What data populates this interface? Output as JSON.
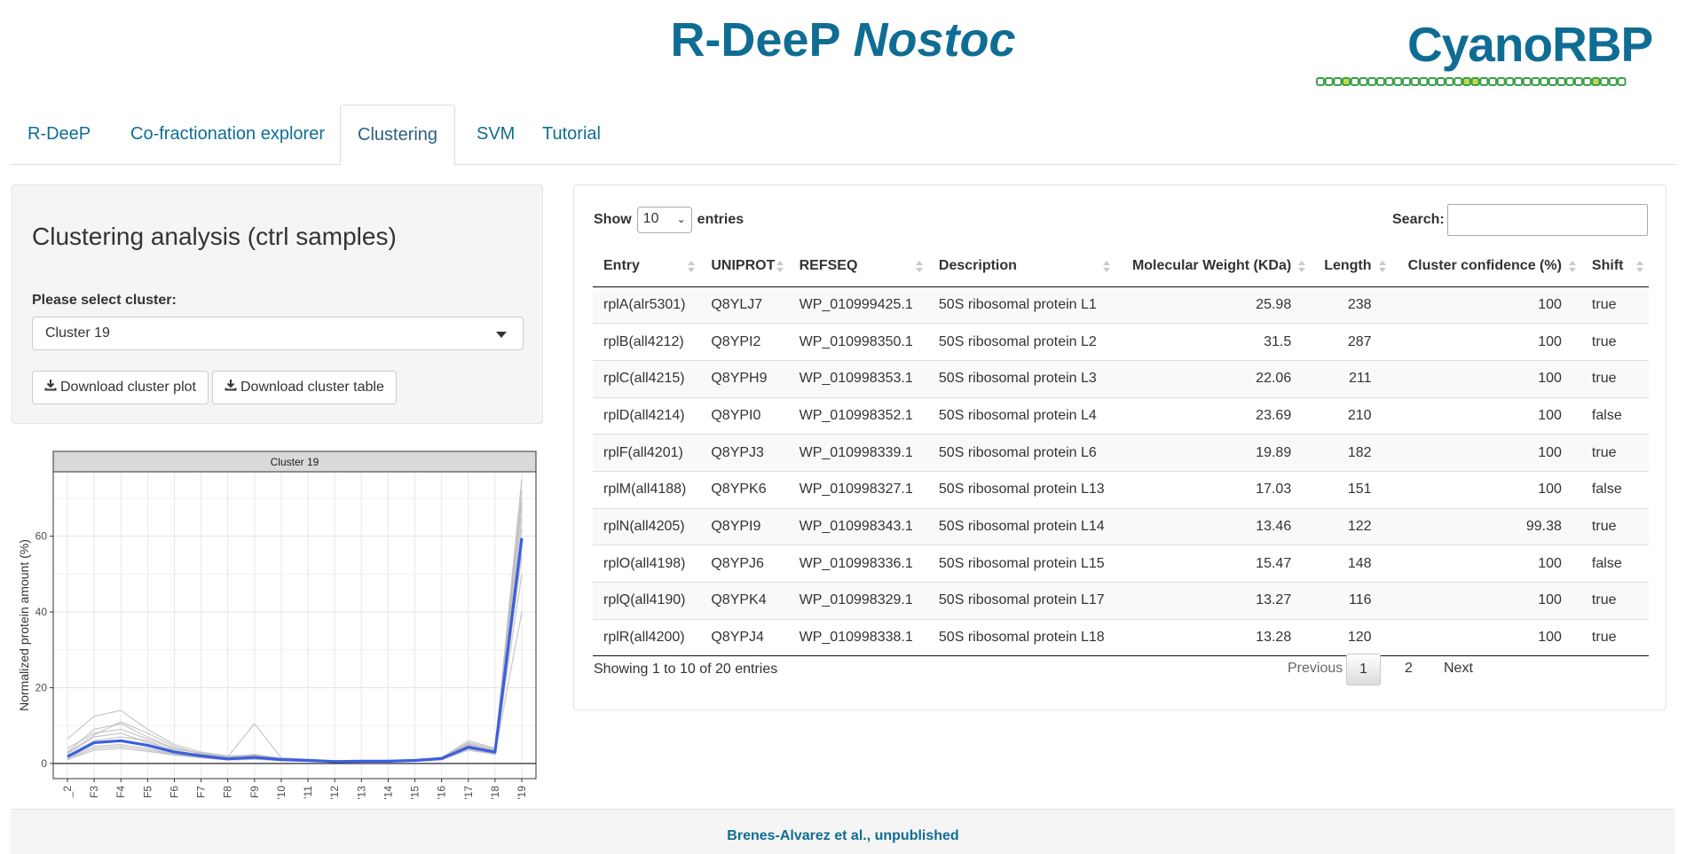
{
  "header": {
    "title_main": "R-DeeP",
    "title_italic": "Nostoc",
    "brand": "CyanoRBP"
  },
  "tabs": [
    {
      "label": "R-DeeP",
      "active": false
    },
    {
      "label": "Co-fractionation explorer",
      "active": false
    },
    {
      "label": "Clustering",
      "active": true
    },
    {
      "label": "SVM",
      "active": false
    },
    {
      "label": "Tutorial",
      "active": false
    }
  ],
  "sidebar": {
    "title": "Clustering analysis (ctrl samples)",
    "select_label": "Please select cluster:",
    "select_value": "Cluster 19",
    "download_plot": "Download cluster plot",
    "download_table": "Download cluster table"
  },
  "chart_data": {
    "type": "line",
    "title": "Cluster 19",
    "ylabel": "Normalized protein amount (%)",
    "xlabel": "",
    "categories": [
      "_2",
      "F3",
      "F4",
      "F5",
      "F6",
      "F7",
      "F8",
      "F9",
      "F10",
      "F11",
      "F12",
      "F13",
      "F14",
      "F15",
      "F16",
      "F17",
      "F18",
      "F19"
    ],
    "tick_labels": [
      "_2",
      "F3",
      "F4",
      "F5",
      "F6",
      "F7",
      "F8",
      "F9",
      "'10",
      "'11",
      "'12",
      "'13",
      "'14",
      "'15",
      "'16",
      "'17",
      "'18",
      "'19"
    ],
    "y_ticks": [
      "0",
      "20",
      "40",
      "60"
    ],
    "ylim": [
      -4,
      77
    ],
    "grid": true,
    "series": [
      {
        "values": [
          1.8,
          5.5,
          6.0,
          4.8,
          3.0,
          2.0,
          1.2,
          1.6,
          1.0,
          0.8,
          0.5,
          0.6,
          0.6,
          0.8,
          1.3,
          4.3,
          3.0,
          59.5
        ],
        "highlight": true
      },
      {
        "values": [
          2.5,
          7.0,
          8.0,
          5.5,
          3.5,
          2.2,
          1.5,
          2.0,
          1.2,
          1.0,
          0.6,
          0.7,
          0.7,
          0.9,
          1.5,
          5.0,
          3.5,
          72.0
        ]
      },
      {
        "values": [
          1.5,
          4.5,
          5.0,
          4.0,
          2.5,
          1.8,
          1.0,
          1.3,
          0.9,
          0.7,
          0.4,
          0.5,
          0.5,
          0.7,
          1.1,
          3.8,
          2.6,
          40.0
        ]
      },
      {
        "values": [
          3.0,
          9.0,
          10.5,
          7.0,
          4.0,
          2.6,
          1.8,
          10.5,
          1.5,
          1.1,
          0.7,
          0.7,
          0.8,
          1.0,
          1.6,
          5.5,
          3.8,
          68.0
        ]
      },
      {
        "values": [
          6.5,
          12.5,
          14.0,
          9.0,
          5.0,
          3.0,
          2.0,
          2.2,
          1.4,
          1.0,
          0.6,
          0.6,
          0.7,
          0.9,
          1.4,
          4.8,
          3.2,
          65.0
        ]
      },
      {
        "values": [
          1.0,
          3.5,
          4.0,
          3.2,
          2.2,
          1.5,
          0.9,
          1.1,
          0.8,
          0.6,
          0.4,
          0.4,
          0.5,
          0.6,
          1.0,
          3.5,
          2.4,
          55.0
        ]
      },
      {
        "values": [
          2.0,
          6.0,
          7.0,
          6.0,
          3.2,
          2.4,
          1.4,
          1.8,
          1.1,
          0.9,
          0.5,
          0.6,
          0.6,
          0.8,
          1.2,
          4.5,
          3.1,
          62.0
        ]
      },
      {
        "values": [
          4.0,
          8.0,
          9.0,
          6.5,
          3.8,
          2.8,
          1.6,
          2.4,
          1.3,
          1.0,
          0.6,
          0.7,
          0.7,
          0.9,
          1.5,
          6.0,
          4.0,
          75.0
        ]
      },
      {
        "values": [
          1.2,
          4.0,
          4.5,
          3.6,
          2.4,
          1.6,
          1.1,
          1.2,
          0.8,
          0.7,
          0.4,
          0.5,
          0.5,
          0.7,
          1.0,
          3.9,
          2.7,
          50.0
        ]
      },
      {
        "values": [
          2.8,
          7.5,
          11.0,
          8.0,
          4.5,
          2.5,
          1.7,
          2.1,
          1.2,
          0.9,
          0.6,
          0.6,
          0.7,
          0.8,
          1.4,
          5.2,
          3.4,
          70.0
        ]
      }
    ]
  },
  "table": {
    "length_label_pre": "Show",
    "length_value": "10",
    "length_label_post": "entries",
    "search_label": "Search:",
    "search_value": "",
    "columns": [
      "Entry",
      "UNIPROT",
      "REFSEQ",
      "Description",
      "Molecular Weight (KDa)",
      "Length",
      "Cluster confidence (%)",
      "Shift"
    ],
    "rows": [
      [
        "rplA(alr5301)",
        "Q8YLJ7",
        "WP_010999425.1",
        "50S ribosomal protein L1",
        "25.98",
        "238",
        "100",
        "true"
      ],
      [
        "rplB(all4212)",
        "Q8YPI2",
        "WP_010998350.1",
        "50S ribosomal protein L2",
        "31.5",
        "287",
        "100",
        "true"
      ],
      [
        "rplC(all4215)",
        "Q8YPH9",
        "WP_010998353.1",
        "50S ribosomal protein L3",
        "22.06",
        "211",
        "100",
        "true"
      ],
      [
        "rplD(all4214)",
        "Q8YPI0",
        "WP_010998352.1",
        "50S ribosomal protein L4",
        "23.69",
        "210",
        "100",
        "false"
      ],
      [
        "rplF(all4201)",
        "Q8YPJ3",
        "WP_010998339.1",
        "50S ribosomal protein L6",
        "19.89",
        "182",
        "100",
        "true"
      ],
      [
        "rplM(all4188)",
        "Q8YPK6",
        "WP_010998327.1",
        "50S ribosomal protein L13",
        "17.03",
        "151",
        "100",
        "false"
      ],
      [
        "rplN(all4205)",
        "Q8YPI9",
        "WP_010998343.1",
        "50S ribosomal protein L14",
        "13.46",
        "122",
        "99.38",
        "true"
      ],
      [
        "rplO(all4198)",
        "Q8YPJ6",
        "WP_010998336.1",
        "50S ribosomal protein L15",
        "15.47",
        "148",
        "100",
        "false"
      ],
      [
        "rplQ(all4190)",
        "Q8YPK4",
        "WP_010998329.1",
        "50S ribosomal protein L17",
        "13.27",
        "116",
        "100",
        "true"
      ],
      [
        "rplR(all4200)",
        "Q8YPJ4",
        "WP_010998338.1",
        "50S ribosomal protein L18",
        "13.28",
        "120",
        "100",
        "true"
      ]
    ],
    "info": "Showing 1 to 10 of 20 entries",
    "pager": {
      "previous": "Previous",
      "pages": [
        "1",
        "2"
      ],
      "current": "1",
      "next": "Next"
    }
  },
  "footer": {
    "text": "Brenes-Alvarez et al., unpublished"
  },
  "colors": {
    "accent": "#0f6d94",
    "highlight_line": "#3b5fe0",
    "bead_green": "#3aa14a",
    "bead_yellow": "#c8d84a"
  }
}
